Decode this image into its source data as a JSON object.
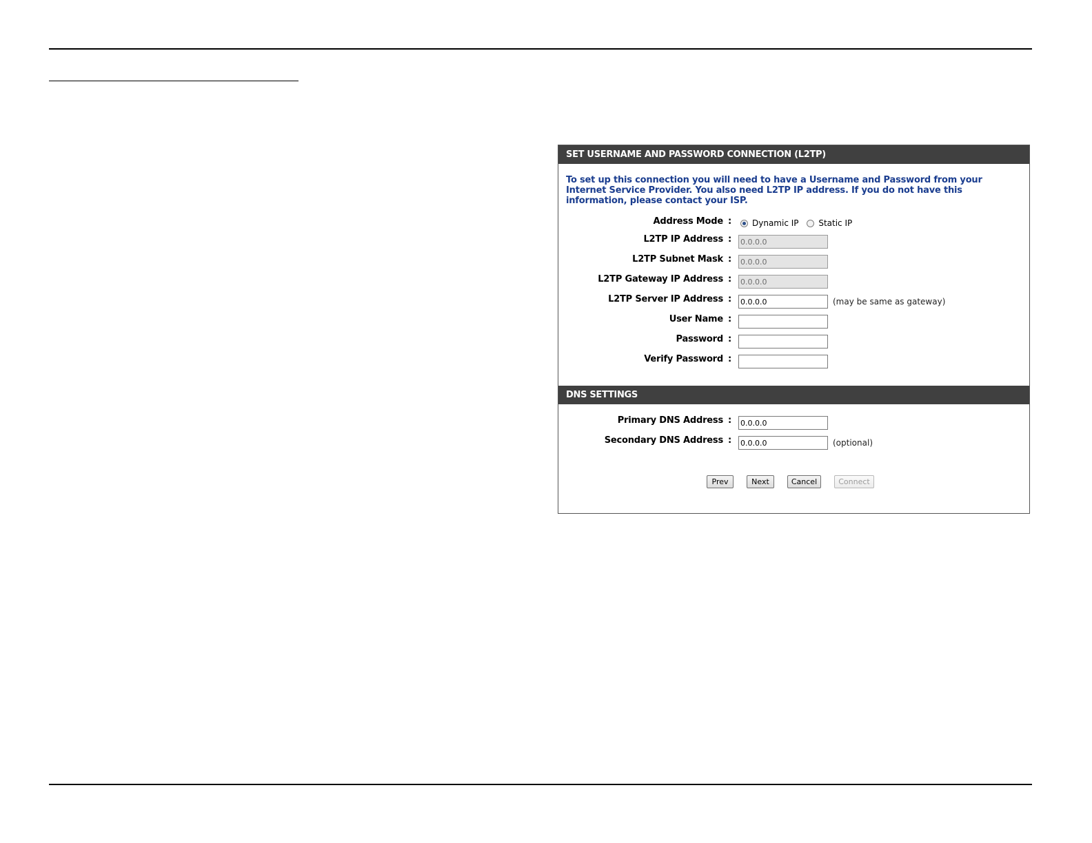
{
  "l2tp_section": {
    "title": "SET USERNAME AND PASSWORD CONNECTION (L2TP)",
    "description": "To set up this connection you will need to have a Username and Password from your Internet Service Provider. You also need L2TP IP address. If you do not have this information, please contact your ISP.",
    "address_mode": {
      "label": "Address Mode",
      "options": [
        {
          "label": "Dynamic IP",
          "checked": true
        },
        {
          "label": "Static IP",
          "checked": false
        }
      ]
    },
    "fields": [
      {
        "label": "L2TP IP Address",
        "value": "0.0.0.0",
        "disabled": true,
        "hint": ""
      },
      {
        "label": "L2TP Subnet Mask",
        "value": "0.0.0.0",
        "disabled": true,
        "hint": ""
      },
      {
        "label": "L2TP Gateway IP Address",
        "value": "0.0.0.0",
        "disabled": true,
        "hint": ""
      },
      {
        "label": "L2TP Server IP Address",
        "value": "0.0.0.0",
        "disabled": false,
        "hint": "(may be same as gateway)"
      },
      {
        "label": "User Name",
        "value": "",
        "disabled": false,
        "hint": ""
      },
      {
        "label": "Password",
        "value": "",
        "disabled": false,
        "hint": ""
      },
      {
        "label": "Verify Password",
        "value": "",
        "disabled": false,
        "hint": ""
      }
    ]
  },
  "dns_section": {
    "title": "DNS SETTINGS",
    "fields": [
      {
        "label": "Primary DNS Address",
        "value": "0.0.0.0",
        "hint": ""
      },
      {
        "label": "Secondary DNS Address",
        "value": "0.0.0.0",
        "hint": "(optional)"
      }
    ]
  },
  "separator": ":",
  "buttons": {
    "prev": "Prev",
    "next": "Next",
    "cancel": "Cancel",
    "connect": "Connect",
    "connect_disabled": true
  },
  "colors": {
    "header_bg": "#404040",
    "intro_text": "#1a3d8f"
  }
}
